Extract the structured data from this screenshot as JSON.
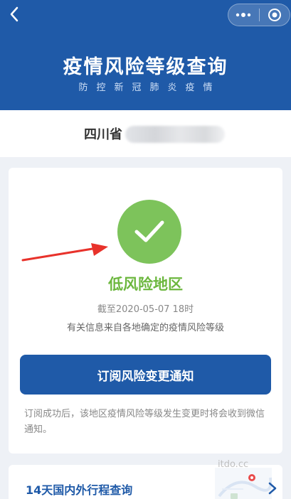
{
  "header": {
    "title": "疫情风险等级查询",
    "subtitle": "防控新冠肺炎疫情",
    "back_icon": "chevron-left-icon",
    "more_icon": "more-dots-icon",
    "close_icon": "target-close-icon",
    "background_color": "#1f5aa8"
  },
  "location": {
    "province": "四川省"
  },
  "result": {
    "status_icon": "check-circle-icon",
    "risk_level": "低风险地区",
    "deadline": "截至2020-05-07 18时",
    "source_note": "有关信息来自各地确定的疫情风险等级",
    "risk_color": "#6cb73e"
  },
  "subscribe": {
    "button_label": "订阅风险变更通知",
    "note": "订阅成功后，该地区疫情风险等级发生变更时将会收到微信通知。"
  },
  "itinerary": {
    "label": "14天国内外行程查询",
    "chevron_icon": "chevron-right-icon"
  },
  "annotation": {
    "arrow_icon": "red-arrow-icon"
  },
  "watermark": {
    "text": "itdo.cc"
  }
}
